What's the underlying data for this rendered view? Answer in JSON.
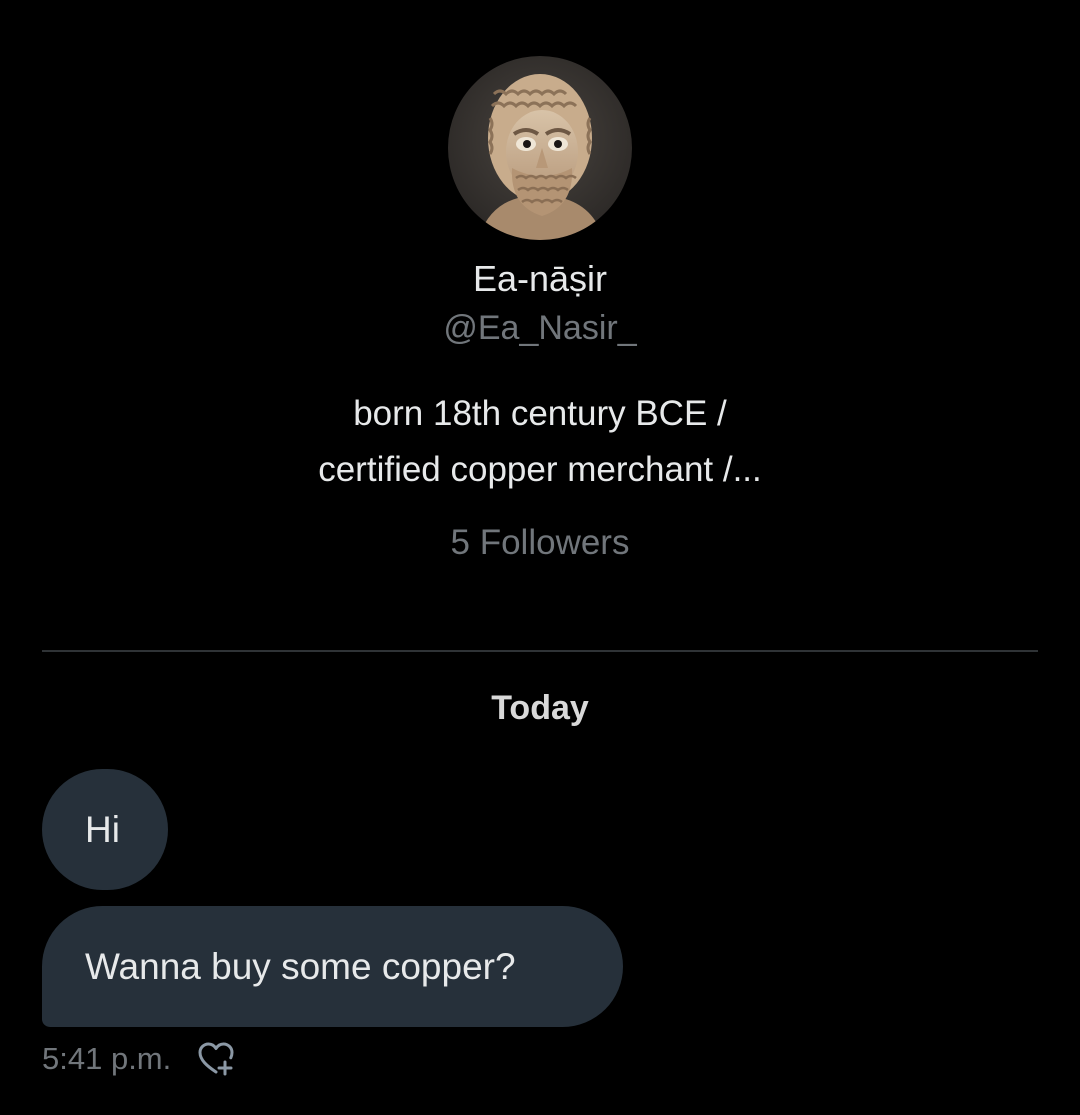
{
  "profile": {
    "avatar_icon": "bearded-statue-avatar",
    "display_name": "Ea-nāṣir",
    "handle": "@Ea_Nasir_",
    "bio_lines": [
      "born 18th century BCE /",
      "certified copper merchant /..."
    ],
    "followers": "5 Followers"
  },
  "conversation": {
    "date_separator": "Today",
    "messages": [
      {
        "text": "Hi"
      },
      {
        "text": "Wanna buy some copper?"
      }
    ],
    "timestamp": "5:41 p.m.",
    "reaction_icon": "heart-plus-icon"
  },
  "colors": {
    "background": "#000000",
    "bubble": "#26303a",
    "primary_text": "#e7e9ea",
    "secondary_text": "#71767b",
    "divider": "#2f3336"
  }
}
